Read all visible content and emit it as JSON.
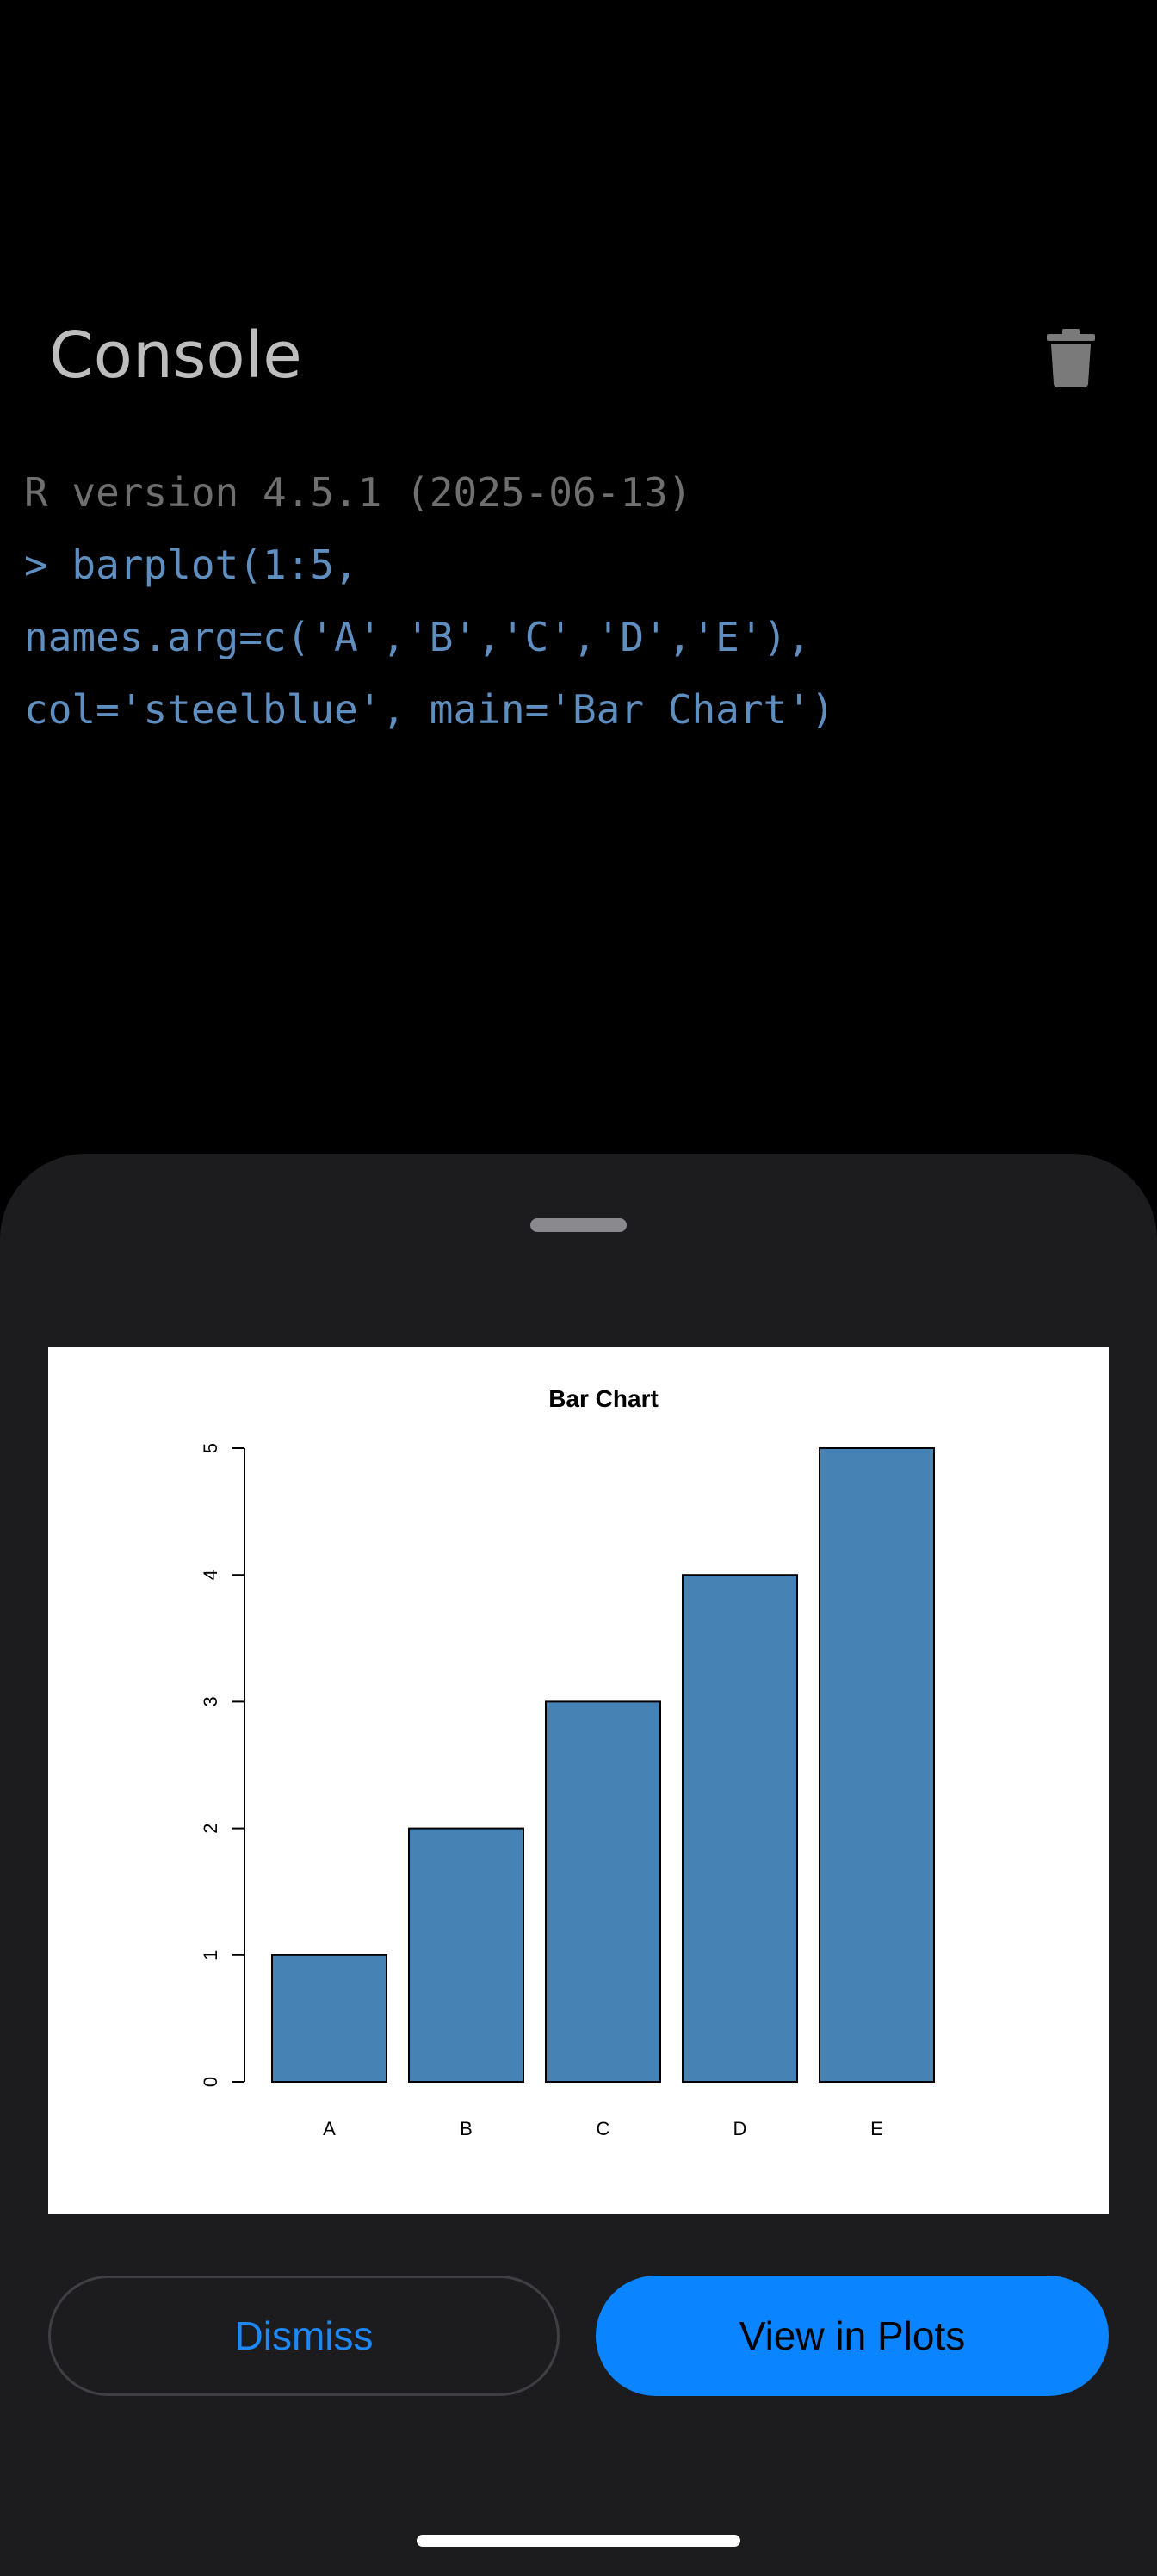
{
  "console": {
    "title": "Console",
    "lines": {
      "version": "R version 4.5.1 (2025-06-13)",
      "cmd1": "> barplot(1:5,",
      "cmd2": "names.arg=c('A','B','C','D','E'),",
      "cmd3": "col='steelblue', main='Bar Chart')"
    },
    "clear_icon": "trash-icon"
  },
  "sheet": {
    "dismiss_label": "Dismiss",
    "view_label": "View in Plots"
  },
  "chart_data": {
    "type": "bar",
    "title": "Bar Chart",
    "categories": [
      "A",
      "B",
      "C",
      "D",
      "E"
    ],
    "values": [
      1,
      2,
      3,
      4,
      5
    ],
    "yticks": [
      "0",
      "1",
      "2",
      "3",
      "4",
      "5"
    ],
    "ylim": [
      0,
      5
    ],
    "bar_color": "#4682b4",
    "xlabel": "",
    "ylabel": ""
  },
  "colors": {
    "accent": "#0a84ff",
    "background": "#000000",
    "sheet": "#1c1c1e"
  }
}
